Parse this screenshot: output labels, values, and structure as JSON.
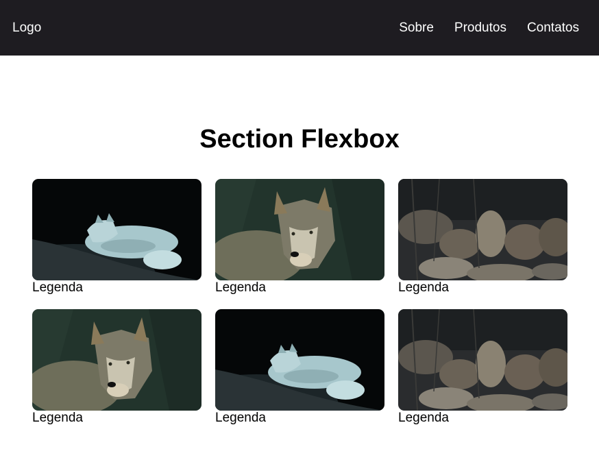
{
  "header": {
    "logo": "Logo",
    "nav": [
      "Sobre",
      "Produtos",
      "Contatos"
    ]
  },
  "section": {
    "title": "Section Flexbox",
    "cards": [
      {
        "caption": "Legenda",
        "image": "white-wolf-lying"
      },
      {
        "caption": "Legenda",
        "image": "gray-wolf-portrait"
      },
      {
        "caption": "Legenda",
        "image": "wolf-pack-rocks"
      },
      {
        "caption": "Legenda",
        "image": "gray-wolf-portrait"
      },
      {
        "caption": "Legenda",
        "image": "white-wolf-lying"
      },
      {
        "caption": "Legenda",
        "image": "wolf-pack-rocks"
      }
    ]
  },
  "colors": {
    "navbar": "#1e1c21",
    "nav_text": "#ffffff"
  }
}
